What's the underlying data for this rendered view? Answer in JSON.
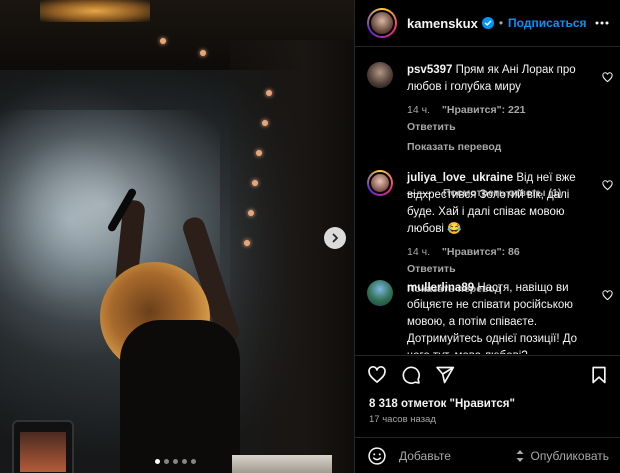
{
  "post": {
    "username": "kamenskux",
    "follow_label": "Подписаться",
    "separator": "•",
    "carousel_dots": 5,
    "carousel_active_index": 0
  },
  "comments": [
    {
      "username": "psv5397",
      "text": "Прям як Ані Лорак про любов і голубка миру",
      "time": "14 ч.",
      "likes": "\"Нравится\": 221",
      "reply_label": "Ответить",
      "translate_label": "Показать перевод",
      "view_replies_label": "Посмотреть ответы (1)"
    },
    {
      "username": "juliya_love_ukraine",
      "text": "Від неї вже відхрестився Золотий вік, далі буде. Хай і далі співає мовою любові 😂",
      "time": "14 ч.",
      "likes": "\"Нравится\": 86",
      "reply_label": "Ответить",
      "translate_label": "Показать перевод"
    },
    {
      "username": "mullerlina89",
      "text": "Настя, навіщо ви обіцяєте не співати російською мовою, а потім співаєте. Дотримуйтесь однієї позиції! До чого тут, мова любові?"
    }
  ],
  "likes_text": "8 318 отметок \"Нравится\"",
  "time_ago": "17 часов назад",
  "add_comment": {
    "placeholder": "Добавьте",
    "post_label": "Опубликовать"
  },
  "colors": {
    "background": "#000000",
    "link_blue": "#0095f6",
    "secondary_text": "#a8a8a8",
    "divider": "#262626"
  }
}
